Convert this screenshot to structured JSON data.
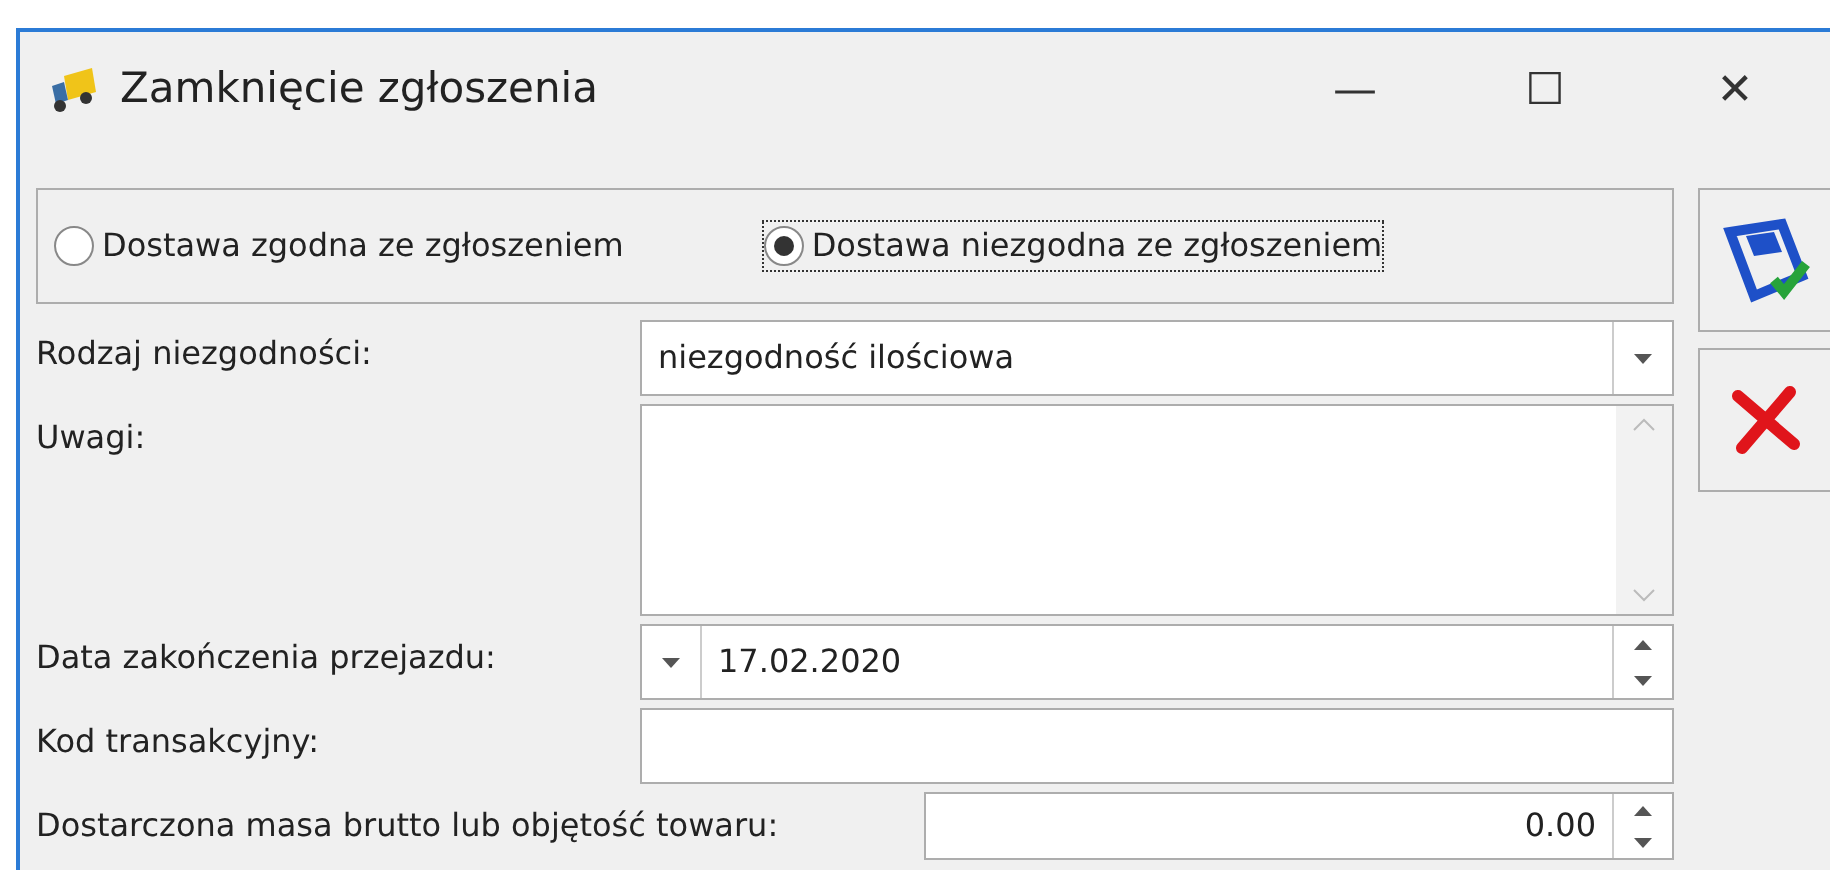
{
  "window": {
    "title": "Zamknięcie zgłoszenia",
    "controls": [
      "—",
      "☐",
      "✕"
    ]
  },
  "delivery_options": [
    {
      "label": "Dostawa zgodna ze zgłoszeniem",
      "selected": false
    },
    {
      "label": "Dostawa niezgodna ze zgłoszeniem",
      "selected": true
    }
  ],
  "fields": [
    {
      "kind": "combo",
      "label": "Rodzaj niezgodności:",
      "value": "niezgodność ilościowa"
    },
    {
      "kind": "memo",
      "label": "Uwagi:"
    },
    {
      "kind": "date",
      "label": "Data zakończenia przejazdu:",
      "value": "17.02.2020"
    },
    {
      "kind": "text",
      "label": "Kod transakcyjny:"
    },
    {
      "kind": "number",
      "label": "Dostarczona masa brutto lub objętość towaru:",
      "value": "0.00"
    }
  ],
  "buttons": [
    {
      "kind": "save"
    },
    {
      "kind": "cancel"
    }
  ]
}
